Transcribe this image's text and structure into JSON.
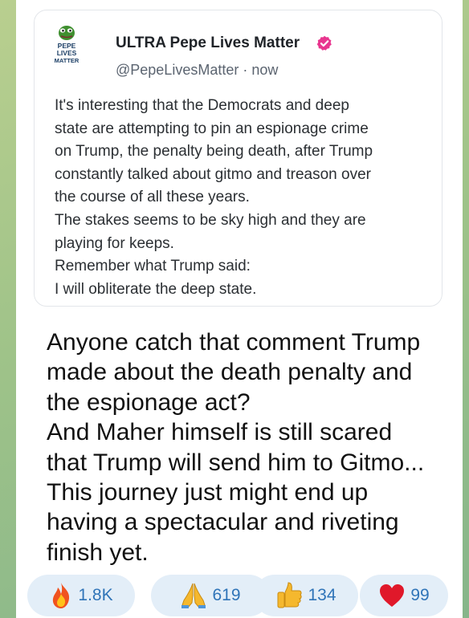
{
  "post": {
    "author": "ULTRA Pepe Lives Matter",
    "handle": "@PepeLivesMatter",
    "separator": "·",
    "time": "now",
    "avatar_text": [
      "PEPE",
      "LIVES",
      "MATTER"
    ],
    "text_lines": [
      "It's interesting that the Democrats and deep",
      "state are attempting to pin an espionage crime",
      "on Trump, the penalty being death, after Trump",
      "constantly talked about gitmo and treason over",
      "the course of all these years.",
      "The stakes seems to be sky high and they are",
      "playing for keeps.",
      "Remember what Trump said:",
      "I will obliterate the deep state."
    ]
  },
  "caption_lines": [
    "Anyone catch that comment Trump",
    "made about the death penalty and",
    "the espionage act?",
    "And Maher himself is still scared",
    "that Trump will send him to Gitmo...",
    "This journey just might end up",
    "having a spectacular and riveting",
    "finish yet."
  ],
  "reactions": [
    {
      "icon": "fire-icon",
      "count": "1.8K"
    },
    {
      "icon": "praying-hands-icon",
      "count": "619"
    },
    {
      "icon": "thumbs-up-icon",
      "count": "134"
    },
    {
      "icon": "heart-icon",
      "count": "99"
    }
  ],
  "colors": {
    "accent": "#2f74b8",
    "chip_bg": "#e3eef8",
    "verified": "#e8368f"
  }
}
